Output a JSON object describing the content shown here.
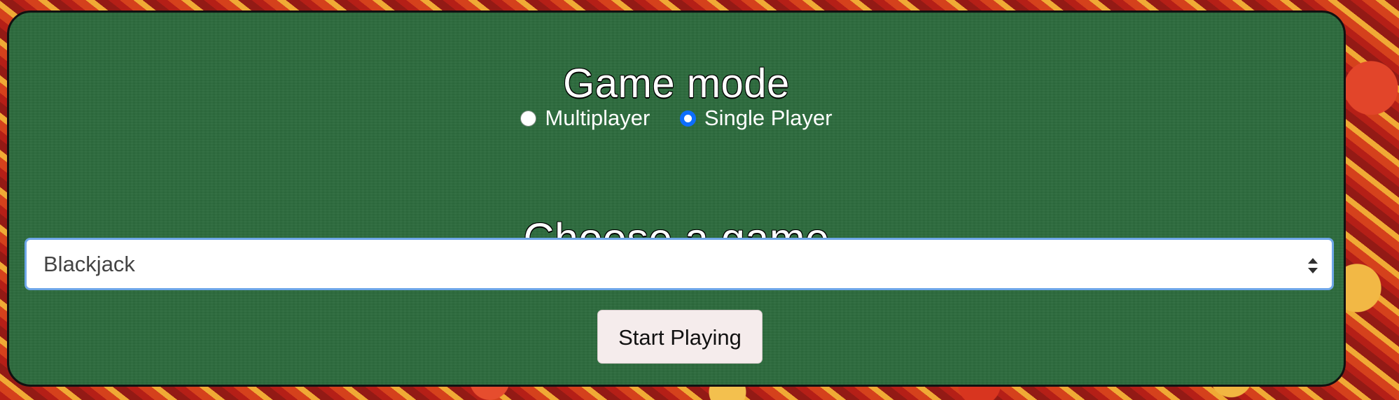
{
  "game_mode": {
    "title": "Game mode",
    "options": [
      {
        "label": "Multiplayer",
        "selected": false
      },
      {
        "label": "Single Player",
        "selected": true
      }
    ]
  },
  "game_selection": {
    "title": "Choose a game",
    "selected_value": "Blackjack"
  },
  "actions": {
    "start_label": "Start Playing"
  },
  "colors": {
    "table_green": "#2d6b3d",
    "selected_radio": "#0d6efd",
    "select_focus_border": "#6ea6e8",
    "button_background": "#f5ecec"
  },
  "icons": {
    "select_indicator": "up-down-chevron-icon"
  }
}
